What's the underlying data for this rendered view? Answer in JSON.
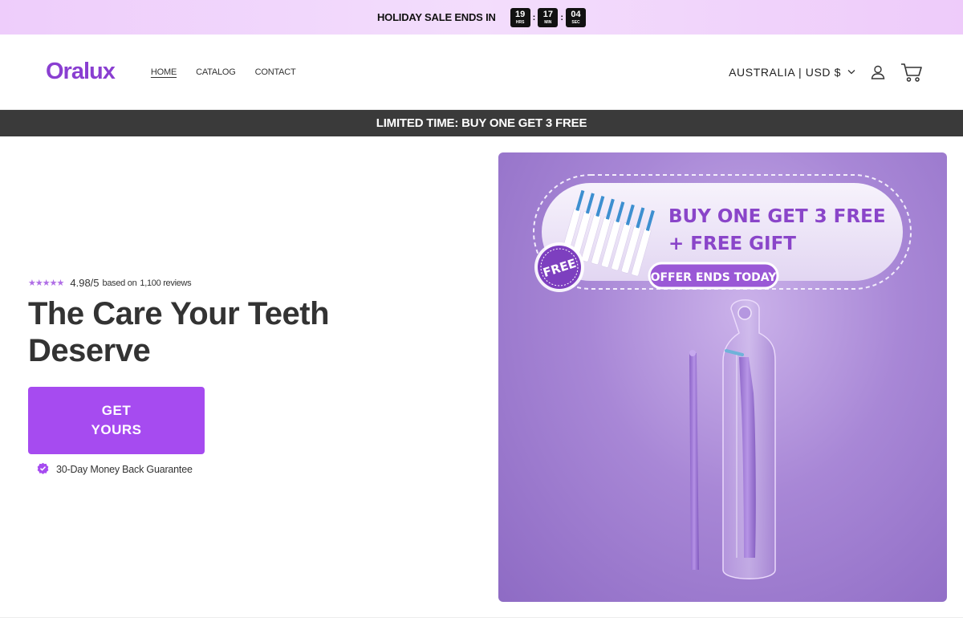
{
  "announcement": {
    "text": "HOLIDAY SALE ENDS IN",
    "timer": [
      {
        "value": "19",
        "label": "HRS"
      },
      {
        "value": "17",
        "label": "MIN"
      },
      {
        "value": "04",
        "label": "SEC"
      }
    ],
    "separator": ":"
  },
  "header": {
    "logo": "Oralux",
    "nav": [
      {
        "label": "HOME",
        "active": true
      },
      {
        "label": "CATALOG",
        "active": false
      },
      {
        "label": "CONTACT",
        "active": false
      }
    ],
    "locale": "AUSTRALIA | USD $",
    "icons": [
      "chevron-down-icon",
      "account-icon",
      "cart-icon"
    ]
  },
  "promo_bar": {
    "text": "LIMITED TIME: BUY ONE GET 3 FREE"
  },
  "hero": {
    "rating": {
      "stars": 5,
      "score": "4.98/5",
      "based_on": "based on",
      "count": "1,100 reviews"
    },
    "headline": "The Care Your Teeth Deserve",
    "cta_label": "GET YOURS",
    "guarantee": "30-Day Money Back Guarantee",
    "image": {
      "offer_line1": "BUY ONE GET 3 FREE",
      "offer_line2": "+ FREE GIFT",
      "offer_badge": "OFFER ENDS TODAY",
      "free_sticker": "FREE"
    }
  },
  "colors": {
    "brand": "#8a3fd1",
    "cta": "#a64bf0",
    "promo_bar": "#3a3a3a",
    "announcement": "#eecdfb"
  }
}
